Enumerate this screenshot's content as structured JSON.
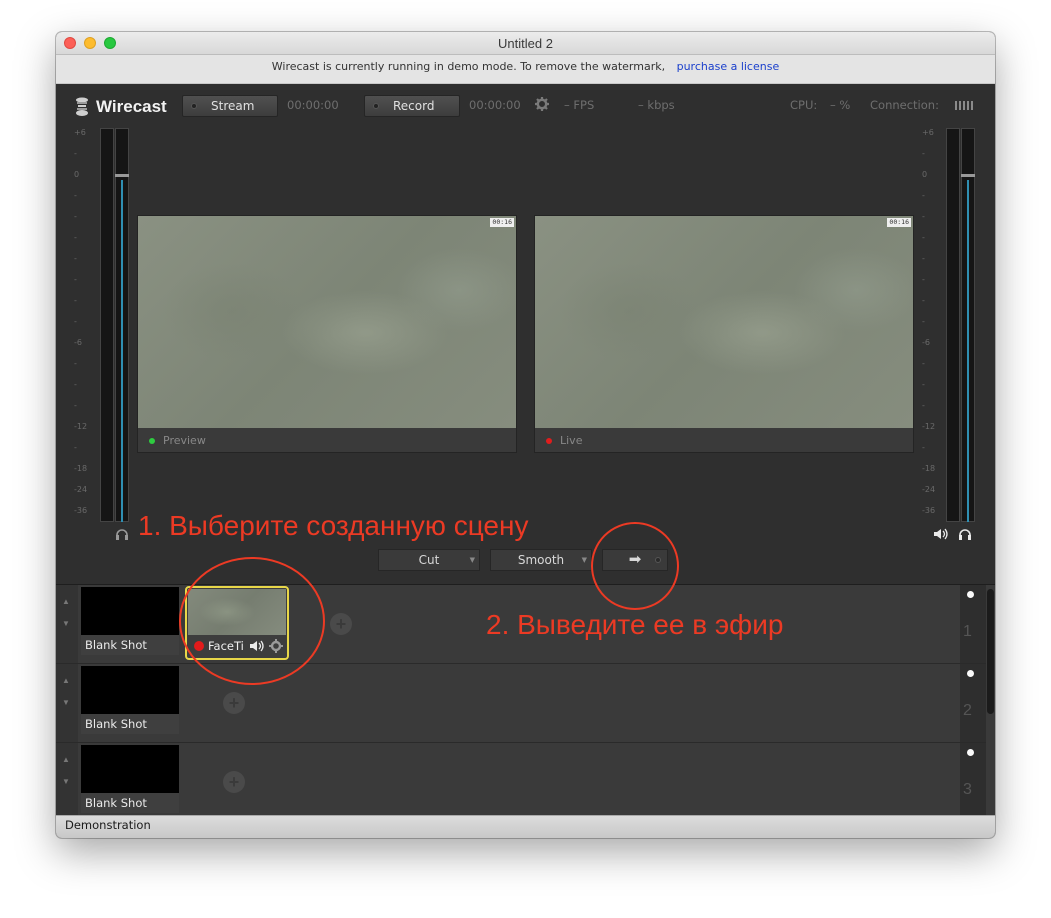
{
  "window": {
    "title": "Untitled 2"
  },
  "banner": {
    "text": "Wirecast is currently running in demo mode. To remove the watermark,",
    "link": "purchase a license"
  },
  "toolbar": {
    "app_name": "Wirecast",
    "stream_label": "Stream",
    "stream_time": "00:00:00",
    "record_label": "Record",
    "record_time": "00:00:00",
    "fps": "– FPS",
    "kbps": "– kbps",
    "cpu_label": "CPU:",
    "cpu_value": "– %",
    "connection_label": "Connection:"
  },
  "meters": {
    "scale_labels": [
      "+6",
      "-",
      "0",
      "-",
      "-",
      "-",
      "-",
      "-",
      "-",
      "-",
      "-6",
      "-",
      "-",
      "-",
      "-12",
      "-",
      "-18",
      "-24",
      "-36"
    ]
  },
  "monitors": {
    "preview": {
      "label": "Preview",
      "timecode": "00:16",
      "status_color": "#2ecc40"
    },
    "live": {
      "label": "Live",
      "timecode": "00:16",
      "status_color": "#e11d1d"
    }
  },
  "transitions": {
    "cut_label": "Cut",
    "smooth_label": "Smooth",
    "go_symbol": "➡"
  },
  "layers": [
    {
      "number": "1",
      "shots": [
        {
          "name": "Blank Shot"
        }
      ],
      "active_shot": {
        "name": "FaceTi"
      }
    },
    {
      "number": "2",
      "shots": [
        {
          "name": "Blank Shot"
        }
      ]
    },
    {
      "number": "3",
      "shots": [
        {
          "name": "Blank Shot"
        }
      ]
    }
  ],
  "status": {
    "text": "Demonstration"
  },
  "annotations": {
    "step1": "1. Выберите созданную сцену",
    "step2": "2. Выведите ее в эфир",
    "color": "#ec3a24"
  }
}
